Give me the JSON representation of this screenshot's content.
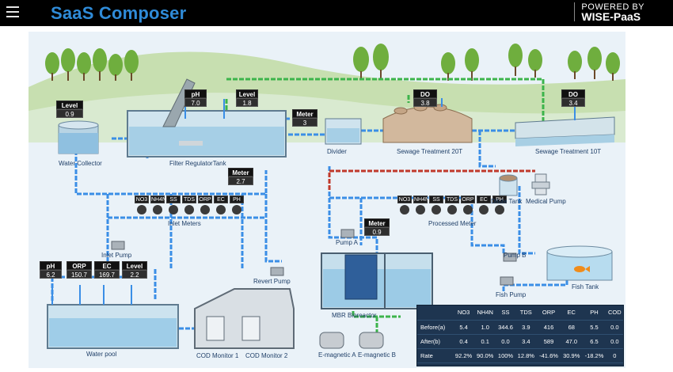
{
  "app": {
    "title": "SaaS Composer",
    "powered_by": "POWERED BY",
    "brand": "WISE-PaaS"
  },
  "labels": {
    "water_collector": "Water Collector",
    "filter_regulator_tank": "Filter RegulatorTank",
    "divider": "Divider",
    "sewage_20t": "Sewage Treatment 20T",
    "sewage_10t": "Sewage Treatment 10T",
    "inlet_meters": "Inlet Meters",
    "processed_meter": "Processed Meter",
    "dilute_tank": "Dilute Tank",
    "medical_pump": "Medical Pump",
    "inlet_pump": "Inlet Pump",
    "pump_a": "Pump A",
    "pump_b": "Pump B",
    "revert_pump": "Revert Pump",
    "mbr_bioreactor": "MBR Bioreactor",
    "fish_tank": "Fish Tank",
    "fish_pump": "Fish Pump",
    "water_pool": "Water pool",
    "cod_monitor_1": "COD Monitor 1",
    "cod_monitor_2": "COD Monitor 2",
    "emagnetic_a": "E-magnetic A",
    "emagnetic_b": "E-magnetic B"
  },
  "readouts": {
    "collector_level": {
      "name": "Level",
      "value": "0.9"
    },
    "filter_ph": {
      "name": "pH",
      "value": "7.0"
    },
    "filter_level": {
      "name": "Level",
      "value": "1.8"
    },
    "meter_top": {
      "name": "Meter",
      "value": "3"
    },
    "do_20t": {
      "name": "DO",
      "value": "3.8"
    },
    "do_10t": {
      "name": "DO",
      "value": "3.4"
    },
    "meter_mid": {
      "name": "Meter",
      "value": "2.7"
    },
    "meter_pump": {
      "name": "Meter",
      "value": "0.9"
    },
    "pool_ph": {
      "name": "pH",
      "value": "6.2"
    },
    "pool_orp": {
      "name": "ORP",
      "value": "150.7"
    },
    "pool_ec": {
      "name": "EC",
      "value": "169.7"
    },
    "pool_level": {
      "name": "Level",
      "value": "2.2"
    }
  },
  "inlet_meter_headers": [
    "NO3",
    "NH4N",
    "SS",
    "TDS",
    "ORP",
    "EC",
    "PH"
  ],
  "processed_meter_headers": [
    "NO3",
    "NH4N",
    "SS",
    "TDS",
    "ORP",
    "EC",
    "PH"
  ],
  "table": {
    "headers": [
      "NO3",
      "NH4N",
      "SS",
      "TDS",
      "ORP",
      "EC",
      "PH",
      "COD"
    ],
    "rows": [
      {
        "label": "Before(a)",
        "values": [
          "5.4",
          "1.0",
          "344.6",
          "3.9",
          "416",
          "68",
          "5.5",
          "0.0"
        ]
      },
      {
        "label": "After(b)",
        "values": [
          "0.4",
          "0.1",
          "0.0",
          "3.4",
          "589",
          "47.0",
          "6.5",
          "0.0"
        ]
      },
      {
        "label": "Rate",
        "values": [
          "92.2%",
          "90.0%",
          "100%",
          "12.8%",
          "-41.6%",
          "30.9%",
          "-18.2%",
          "0"
        ]
      }
    ]
  },
  "colors": {
    "pipe_blue": "#3a8ee6",
    "pipe_green": "#3cb44b",
    "pipe_red": "#c0392b",
    "accent": "#2f8bd8"
  }
}
